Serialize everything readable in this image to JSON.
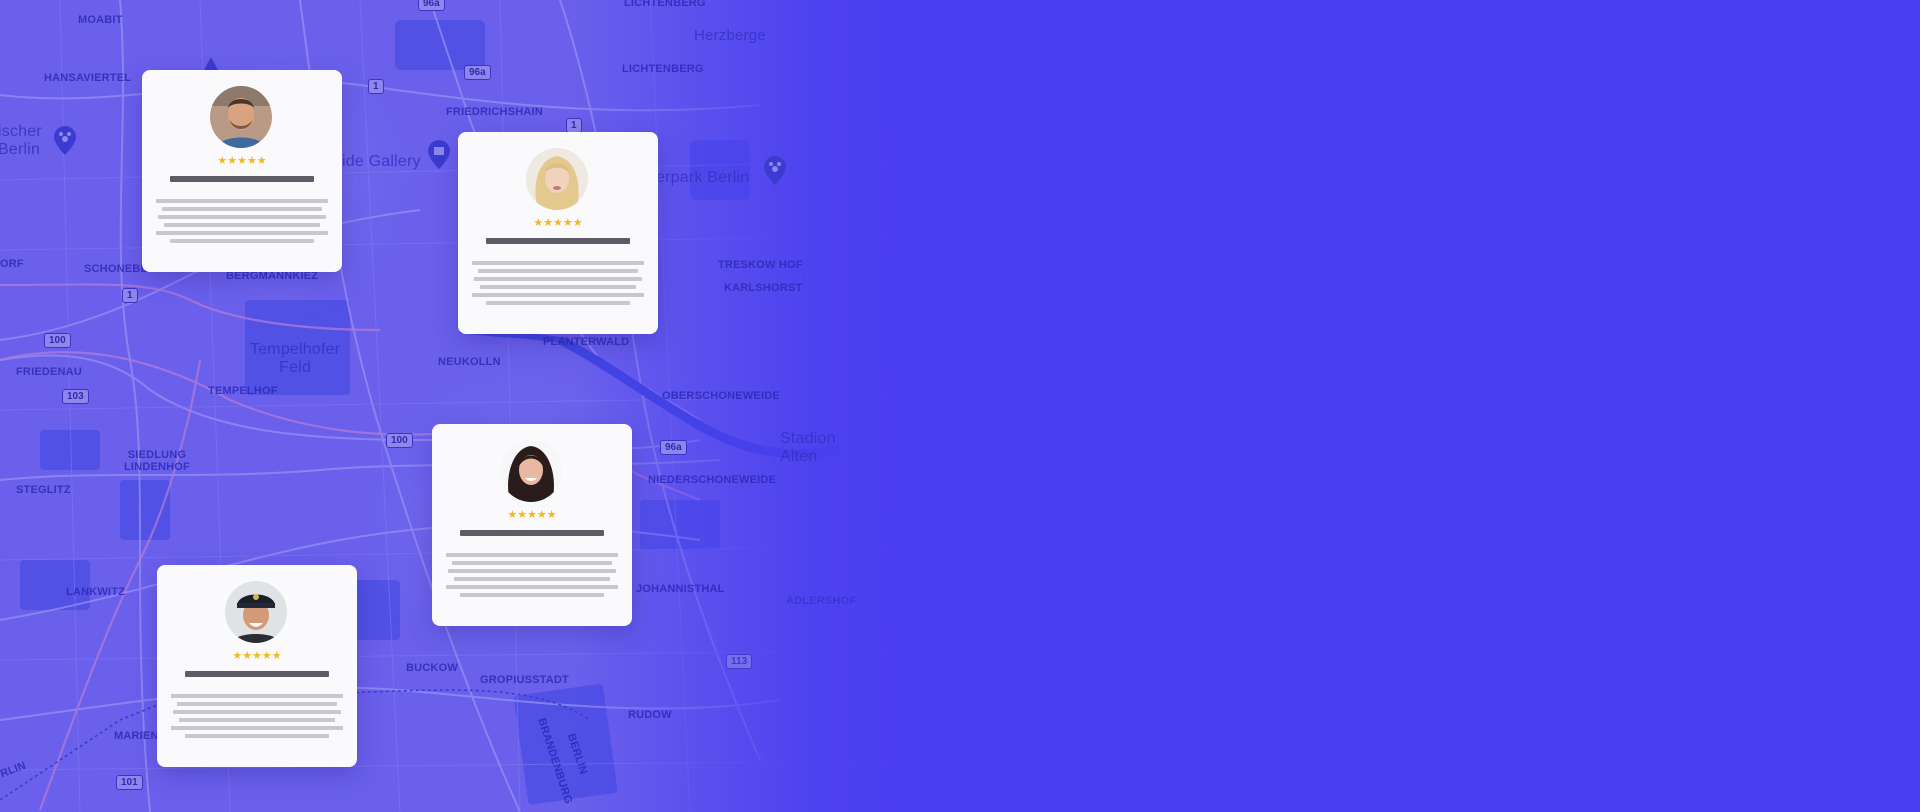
{
  "colors": {
    "background": "#4a3df0",
    "map_tint": "#6a60ec",
    "card_bg": "#fafafd",
    "star": "#f2b81d",
    "name_placeholder": "#5c5c66",
    "text_placeholder": "#c8c8cc"
  },
  "map": {
    "labels": [
      {
        "text": "MOABIT"
      },
      {
        "text": "LICHTENBERG"
      },
      {
        "text": "Herzberge"
      },
      {
        "text": "HANSAVIERTEL"
      },
      {
        "text": "LICHTENBERG"
      },
      {
        "text": "FRIEDRICHSHAIN"
      },
      {
        "text": "ischer\nBerlin"
      },
      {
        "text": "ide Gallery"
      },
      {
        "text": "erpark Berlin"
      },
      {
        "text": "ORF"
      },
      {
        "text": "SCHONEBE"
      },
      {
        "text": "BERGMANNKIEZ"
      },
      {
        "text": "TRESKOW HOF"
      },
      {
        "text": "KARLSHORST"
      },
      {
        "text": "Tempelhofer\nFeld"
      },
      {
        "text": "FRIEDENAU"
      },
      {
        "text": "NEUKOLLN"
      },
      {
        "text": "PLANTERWALD"
      },
      {
        "text": "TEMPELHOF"
      },
      {
        "text": "OBERSCHONEWEIDE"
      },
      {
        "text": "Stadion\nAlten"
      },
      {
        "text": "SIEDLUNG\nLINDENHOF"
      },
      {
        "text": "NIEDERSCHONEWEIDE"
      },
      {
        "text": "STEGLITZ"
      },
      {
        "text": "LANKWITZ"
      },
      {
        "text": "JOHANNISTHAL"
      },
      {
        "text": "ADLERSHOF"
      },
      {
        "text": "MARIEN"
      },
      {
        "text": "BUCKOW"
      },
      {
        "text": "GROPIUSSTADT"
      },
      {
        "text": "RUDOW"
      },
      {
        "text": "RLIN"
      },
      {
        "text": "BRANDENBURG"
      },
      {
        "text": "BERLIN"
      }
    ],
    "road_badges": [
      {
        "text": "96a"
      },
      {
        "text": "96a"
      },
      {
        "text": "1"
      },
      {
        "text": "1"
      },
      {
        "text": "1"
      },
      {
        "text": "100"
      },
      {
        "text": "103"
      },
      {
        "text": "100"
      },
      {
        "text": "96a"
      },
      {
        "text": "113"
      },
      {
        "text": "101"
      }
    ],
    "poi_icons": [
      "paw-icon",
      "gallery-icon",
      "paw-icon",
      "landmark-icon"
    ]
  },
  "reviews": [
    {
      "avatar": "man-avatar",
      "rating": 5,
      "stars": "★★★★★"
    },
    {
      "avatar": "blonde-woman-avatar",
      "rating": 5,
      "stars": "★★★★★"
    },
    {
      "avatar": "dark-hair-woman-avatar",
      "rating": 5,
      "stars": "★★★★★"
    },
    {
      "avatar": "captain-hat-man-avatar",
      "rating": 5,
      "stars": "★★★★★"
    }
  ]
}
